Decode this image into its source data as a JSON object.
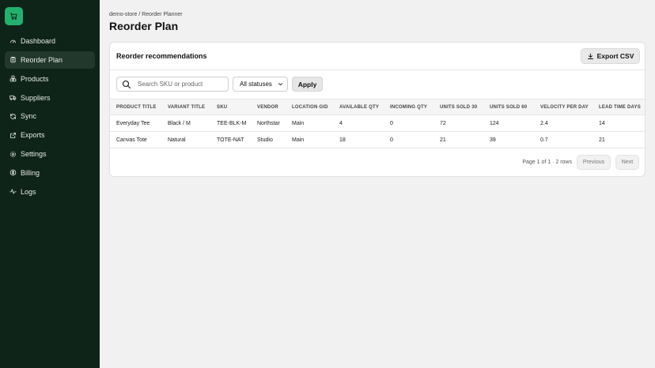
{
  "sidebar": {
    "items": [
      {
        "label": "Dashboard",
        "icon": "gauge-icon"
      },
      {
        "label": "Reorder Plan",
        "icon": "clipboard-icon",
        "active": true
      },
      {
        "label": "Products",
        "icon": "boxes-icon"
      },
      {
        "label": "Suppliers",
        "icon": "truck-icon"
      },
      {
        "label": "Sync",
        "icon": "refresh-icon"
      },
      {
        "label": "Exports",
        "icon": "export-icon"
      },
      {
        "label": "Settings",
        "icon": "gear-icon"
      },
      {
        "label": "Billing",
        "icon": "dollar-icon"
      },
      {
        "label": "Logs",
        "icon": "activity-icon"
      }
    ]
  },
  "header": {
    "breadcrumb": "demo-store / Reorder Planner",
    "title": "Reorder Plan"
  },
  "card": {
    "title": "Reorder recommendations",
    "export_label": "Export CSV"
  },
  "filters": {
    "search_placeholder": "Search SKU or product",
    "status_value": "All statuses",
    "apply_label": "Apply"
  },
  "table": {
    "columns": [
      "PRODUCT TITLE",
      "VARIANT TITLE",
      "SKU",
      "VENDOR",
      "LOCATION GID",
      "AVAILABLE QTY",
      "INCOMING QTY",
      "UNITS SOLD 30",
      "UNITS SOLD 60",
      "VELOCITY PER DAY",
      "LEAD TIME DAYS"
    ],
    "rows": [
      [
        "Everyday Tee",
        "Black / M",
        "TEE-BLK-M",
        "Northstar",
        "Main",
        "4",
        "0",
        "72",
        "124",
        "2.4",
        "14"
      ],
      [
        "Canvas Tote",
        "Natural",
        "TOTE-NAT",
        "Studio",
        "Main",
        "18",
        "0",
        "21",
        "39",
        "0.7",
        "21"
      ]
    ]
  },
  "pagination": {
    "info": "Page 1 of 1 · 2 rows",
    "previous_label": "Previous",
    "next_label": "Next"
  },
  "colors": {
    "sidebar_bg": "#0f2419",
    "logo_bg": "#23b26d"
  }
}
